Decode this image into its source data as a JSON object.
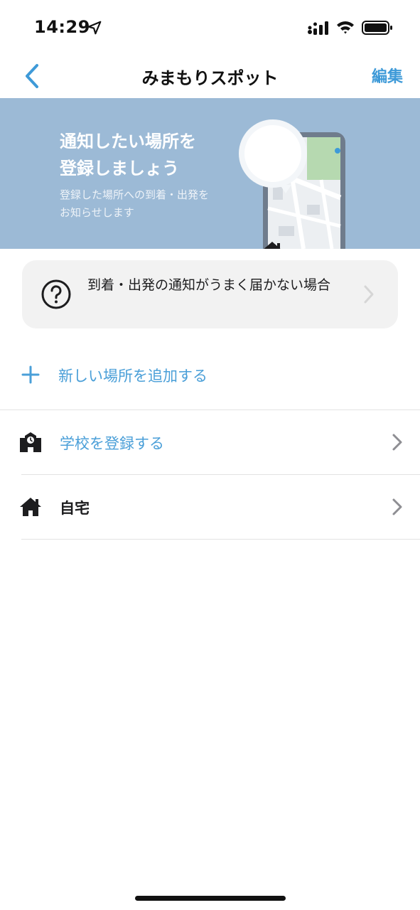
{
  "status_bar": {
    "time": "14:29",
    "icons": [
      "location-arrow-icon",
      "cellular-signal-icon",
      "wifi-icon",
      "battery-icon"
    ]
  },
  "nav": {
    "title": "みまもりスポット",
    "edit_label": "編集",
    "back_icon": "chevron-left-icon"
  },
  "banner": {
    "title": "通知したい場所を\n登録しましょう",
    "subtitle": "登録した場所への到着・出発を\nお知らせします",
    "background": "#9cbad6"
  },
  "help": {
    "text": "到着・出発の通知がうまく届かない場合",
    "icon": "question-circle-icon"
  },
  "add_place": {
    "label": "新しい場所を追加する",
    "icon": "plus-icon"
  },
  "places": [
    {
      "label": "学校を登録する",
      "icon": "school-icon"
    },
    {
      "label": "自宅",
      "icon": "home-icon"
    }
  ],
  "colors": {
    "accent": "#4a9fd8",
    "banner": "#9cbad6",
    "card": "#f2f2f2"
  }
}
